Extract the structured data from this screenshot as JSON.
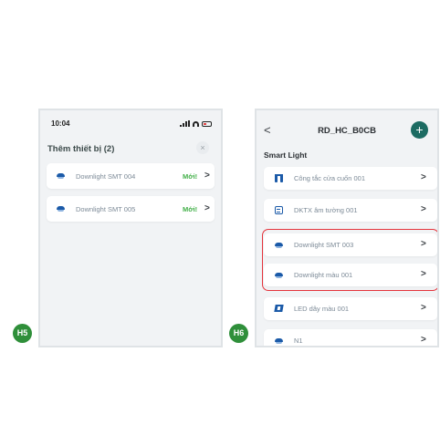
{
  "screen_h5": {
    "status_time": "10:04",
    "title": "Thêm thiết bị (2)",
    "close_label": "×",
    "items": [
      {
        "label": "Downlight SMT 004",
        "badge": "Mới!",
        "icon": "downlight-icon"
      },
      {
        "label": "Downlight SMT 005",
        "badge": "Mới!",
        "icon": "downlight-icon"
      }
    ]
  },
  "screen_h6": {
    "back_label": "<",
    "title": "RD_HC_B0CB",
    "add_label": "+",
    "section": "Smart Light",
    "items": [
      {
        "label": "Công tắc cửa cuốn 001",
        "icon": "curtain-icon"
      },
      {
        "label": "DKTX âm tường 001",
        "icon": "wall-panel-icon"
      },
      {
        "label": "Downlight SMT 003",
        "icon": "downlight-icon"
      },
      {
        "label": "Downlight màu 001",
        "icon": "downlight-icon"
      },
      {
        "label": "LED dây màu 001",
        "icon": "led-strip-icon"
      },
      {
        "label": "N1",
        "icon": "downlight-icon"
      }
    ]
  },
  "chevron": ">",
  "badges": {
    "h5": "H5",
    "h6": "H6"
  },
  "colors": {
    "accent": "#1c6b62",
    "new_badge": "#43b049",
    "highlight": "#e4343c",
    "step_badge": "#2f8f3a",
    "icon": "#1b5aa8"
  }
}
